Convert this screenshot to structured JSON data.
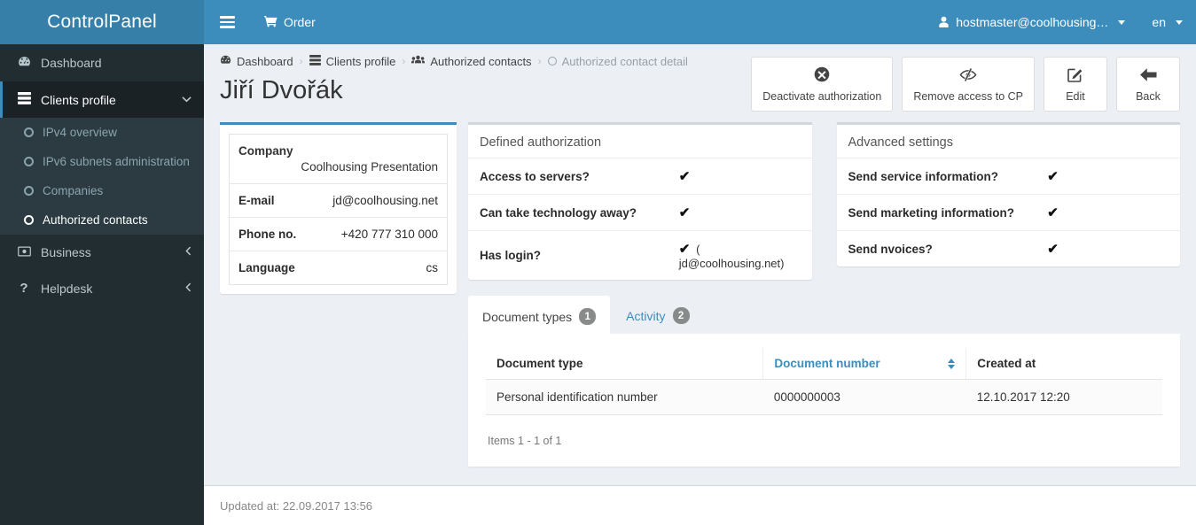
{
  "brand": {
    "title": "ControlPanel"
  },
  "topnav": {
    "menu_toggle_label": "Toggle navigation",
    "order_label": "Order",
    "order_icon": "cart-icon",
    "user_label": "hostmaster@coolhousing…",
    "user_icon": "user-icon",
    "language_label": "en"
  },
  "sidebar": {
    "items": [
      {
        "label": "Dashboard",
        "icon": "dashboard-icon",
        "glyph": "◔",
        "active": false,
        "arrow": ""
      },
      {
        "label": "Clients profile",
        "icon": "server-stack-icon",
        "glyph": "☰",
        "active": true,
        "arrow": "⌄"
      },
      {
        "label": "Business",
        "icon": "money-bill-icon",
        "glyph": "⌸",
        "active": false,
        "arrow": "‹"
      },
      {
        "label": "Helpdesk",
        "icon": "question-mark-icon",
        "glyph": "?",
        "active": false,
        "arrow": "‹"
      }
    ],
    "submenu": [
      {
        "label": "IPv4 overview",
        "active": false
      },
      {
        "label": "IPv6 subnets administration",
        "active": false
      },
      {
        "label": "Companies",
        "active": false
      },
      {
        "label": "Authorized contacts",
        "active": true
      }
    ]
  },
  "breadcrumb": [
    {
      "label": "Dashboard",
      "icon": "dashboard-icon"
    },
    {
      "label": "Clients profile",
      "icon": "server-stack-icon"
    },
    {
      "label": "Authorized contacts",
      "icon": "users-icon"
    },
    {
      "label": "Authorized contact detail",
      "icon": "circle-icon"
    }
  ],
  "page": {
    "title": "Jiří Dvořák"
  },
  "actions": [
    {
      "label": "Deactivate authorization",
      "icon": "times-circle-icon"
    },
    {
      "label": "Remove access to CP",
      "icon": "eye-slash-icon"
    },
    {
      "label": "Edit",
      "icon": "pencil-square-icon"
    },
    {
      "label": "Back",
      "icon": "arrow-left-icon"
    }
  ],
  "info_card": {
    "company_label": "Company",
    "company_value": "Coolhousing Presentation",
    "rows": [
      {
        "label": "E-mail",
        "value": "jd@coolhousing.net"
      },
      {
        "label": "Phone no.",
        "value": "+420 777 310 000"
      },
      {
        "label": "Language",
        "value": "cs"
      }
    ]
  },
  "defined_authorization": {
    "title": "Defined authorization",
    "rows": [
      {
        "label": "Access to servers?",
        "value": "✔",
        "note": ""
      },
      {
        "label": "Can take technology away?",
        "value": "✔",
        "note": ""
      },
      {
        "label": "Has login?",
        "value": "✔",
        "note": "( jd@coolhousing.net)"
      }
    ]
  },
  "advanced_settings": {
    "title": "Advanced settings",
    "rows": [
      {
        "label": "Send service information?",
        "value": "✔",
        "note": ""
      },
      {
        "label": "Send marketing information?",
        "value": "✔",
        "note": ""
      },
      {
        "label": "Send nvoices?",
        "value": "✔",
        "note": ""
      }
    ]
  },
  "tabs": [
    {
      "label": "Document types",
      "badge": "1",
      "active": true
    },
    {
      "label": "Activity",
      "badge": "2",
      "active": false
    }
  ],
  "table": {
    "columns": [
      {
        "label": "Document type",
        "sortable": false
      },
      {
        "label": "Document number",
        "sortable": true
      },
      {
        "label": "Created at",
        "sortable": false
      }
    ],
    "rows": [
      {
        "document_type": "Personal identification number",
        "document_number": "0000000003",
        "created_at": "12.10.2017 12:20"
      }
    ],
    "items_count": "Items 1 - 1 of 1"
  },
  "footer": {
    "updated_at": "Updated at: 22.09.2017 13:56"
  },
  "colors": {
    "brand_dark": "#367fa9",
    "brand": "#3c8dbc",
    "sidebar_bg": "#222d32",
    "sidebar_active": "#1a2226",
    "submenu_bg": "#2c3b41",
    "page_bg": "#ecf0f5",
    "link": "#3c8dbc",
    "badge": "#888b8a"
  }
}
